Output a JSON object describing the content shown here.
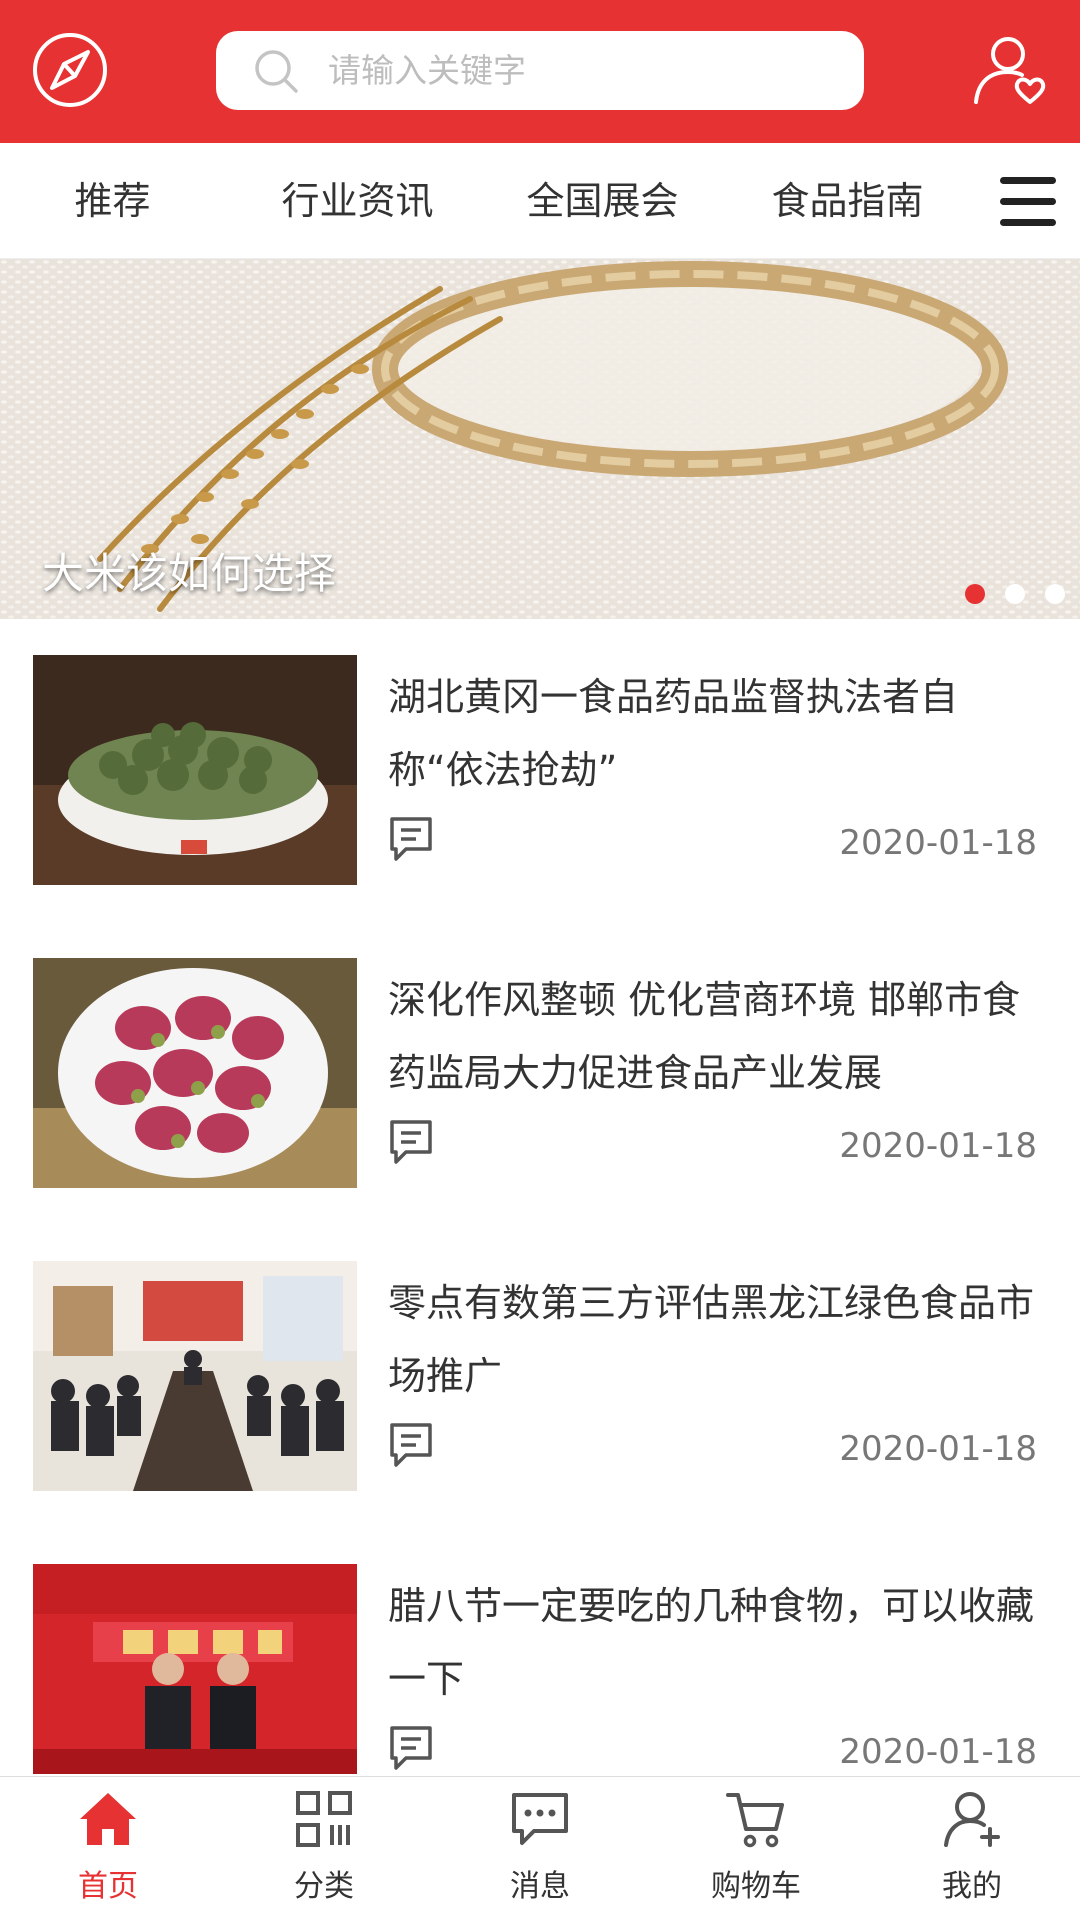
{
  "header": {
    "search_placeholder": "请输入关键字",
    "accent_color": "#e63232",
    "left_icon": "compass-icon",
    "right_icon": "user-heart-icon"
  },
  "tabs": [
    {
      "label": "推荐"
    },
    {
      "label": "行业资讯"
    },
    {
      "label": "全国展会"
    },
    {
      "label": "食品指南"
    }
  ],
  "banner": {
    "caption": "大米该如何选择",
    "slide_count": 3,
    "active_slide": 1
  },
  "news": [
    {
      "title": "湖北黄冈一食品药品监督执法者自称“依法抢劫”",
      "date": "2020-01-18"
    },
    {
      "title": "深化作风整顿 优化营商环境 邯郸市食药监局大力促进食品产业发展",
      "date": "2020-01-18"
    },
    {
      "title": "零点有数第三方评估黑龙江绿色食品市场推广",
      "date": "2020-01-18"
    },
    {
      "title": "腊八节一定要吃的几种食物，可以收藏一下",
      "date": "2020-01-18"
    }
  ],
  "tabbar": [
    {
      "label": "首页",
      "icon": "home-icon",
      "active": true
    },
    {
      "label": "分类",
      "icon": "grid-icon"
    },
    {
      "label": "消息",
      "icon": "message-icon"
    },
    {
      "label": "购物车",
      "icon": "cart-icon"
    },
    {
      "label": "我的",
      "icon": "user-add-icon"
    }
  ]
}
